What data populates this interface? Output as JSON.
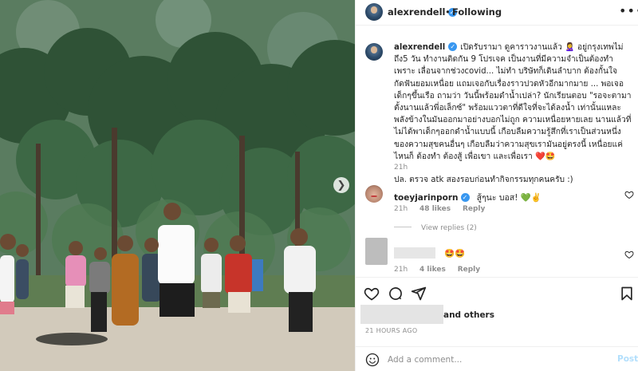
{
  "post": {
    "owner": "alexrendell",
    "follow_status": "Following",
    "caption_paragraphs": [
      "เปิดรับรามา ดูคาราวงานแล้ว 🙎‍♀️ อยู่กรุงเทพไม่ถึง5 วัน ทำงานติดกัน 9 โปรเจค เป็นงานที่มีความจำเป็นต้องทำเพราะ เลื่อนจากช่วงcovid... ไม่ทำ บริษัทก็เดินลำบาก ต้องกั้นใจกัดฟันยอมเหนื่อย แถมเจอกับเรื่องราวปวดหัวอีกมากมาย ... พอเจอเด็กๆขึ้นเรือ ถามว่า วันนี้พร้อมดำน้ำเปล่า? นักเรียนตอบ \"รอจะตามาตั้งนานแล้วพี่อเล็กซ์\" พร้อมแววตาที่ดีใจที่จะได้ลงน้ำ เท่านั้นแหละ พลังข้างในมันออกมาอย่างบอกไม่ถูก ความเหนื่อยหายเลย นานแล้วที่ไม่ได้พาเด็กๆออกดำน้ำแบบนี้ เกือบลืมความรู้สึกที่เราเป็นส่วนหนึ่งของความสุขคนอื่นๆ เกือบลืมว่าความสุขเรามันอยู่ตรงนี้ เหนื่อยแค่ไหนก็ ต้องทำ ต้องสู้ เพื่อเขา และเพื่อเรา ❤️🤩",
      "ปล. ตรวจ atk สองรอบก่อนทำกิจกรรมทุกคนครับ :)"
    ],
    "caption_time": "21h",
    "likes_suffix": "and others",
    "posted_ago": "21 HOURS AGO"
  },
  "comments": [
    {
      "user": "toeyjarinporn",
      "text": "สู้ๆนะ บอส! 💚✌️",
      "time": "21h",
      "likes": "48 likes",
      "reply": "Reply",
      "view_replies": "View replies (2)"
    },
    {
      "user": "",
      "text": "🤩🤩",
      "time": "21h",
      "likes": "4 likes",
      "reply": "Reply"
    }
  ],
  "composer": {
    "placeholder": "Add a comment...",
    "post_label": "Post"
  },
  "colors": {
    "verified": "#3897f0",
    "like_red": "#ed4956",
    "post_disabled": "#b2dffc",
    "muted": "#8e8e8e"
  },
  "icons": [
    "next-arrow-icon",
    "more-options-icon",
    "heart-icon",
    "comment-icon",
    "share-icon",
    "bookmark-icon",
    "emoji-icon",
    "verified-badge-icon"
  ]
}
